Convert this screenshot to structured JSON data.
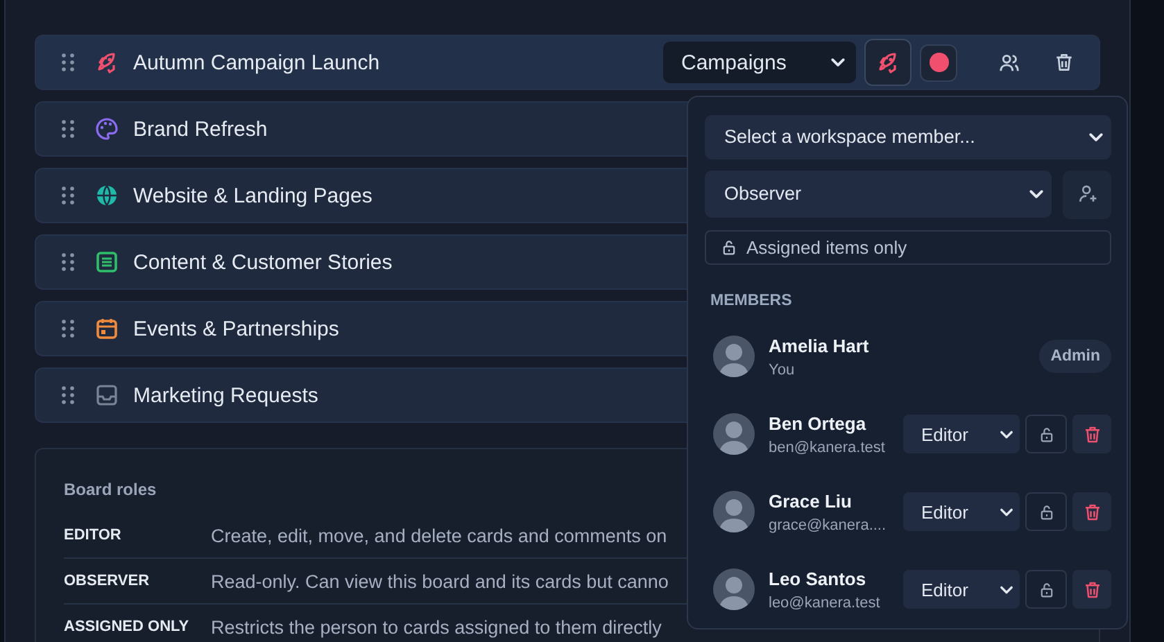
{
  "boards": [
    {
      "title": "Autumn Campaign Launch",
      "kind": "rocket",
      "color": "#f0506e",
      "selected": true,
      "category": "Campaigns"
    },
    {
      "title": "Brand Refresh",
      "kind": "palette",
      "color": "#8b6cf0",
      "selected": false
    },
    {
      "title": "Website & Landing Pages",
      "kind": "globe",
      "color": "#20b8a8",
      "selected": false
    },
    {
      "title": "Content & Customer Stories",
      "kind": "list",
      "color": "#2fbf6a",
      "selected": false
    },
    {
      "title": "Events & Partnerships",
      "kind": "calendar",
      "color": "#f08a3c",
      "selected": false
    },
    {
      "title": "Marketing Requests",
      "kind": "inbox",
      "color": "#7a8496",
      "selected": false
    }
  ],
  "board_roles": {
    "title": "Board roles",
    "roles": [
      {
        "name": "EDITOR",
        "description": "Create, edit, move, and delete cards and comments on"
      },
      {
        "name": "OBSERVER",
        "description": "Read-only. Can view this board and its cards but canno"
      },
      {
        "name": "ASSIGNED ONLY",
        "description": "Restricts the person to cards assigned to them directly"
      }
    ]
  },
  "share_popover": {
    "member_select": {
      "placeholder": "Select a workspace member..."
    },
    "role_select": {
      "value": "Observer"
    },
    "assigned_only": {
      "label": "Assigned items only",
      "checked": false
    },
    "members_heading": "MEMBERS",
    "members": [
      {
        "name": "Amelia Hart",
        "detail": "You",
        "kind": "admin",
        "role": "Admin"
      },
      {
        "name": "Ben Ortega",
        "detail": "ben@kanera.test",
        "kind": "member",
        "role": "Editor",
        "assigned_only": false
      },
      {
        "name": "Grace Liu",
        "detail": "grace@kanera....",
        "kind": "member",
        "role": "Editor",
        "assigned_only": false
      },
      {
        "name": "Leo Santos",
        "detail": "leo@kanera.test",
        "kind": "member",
        "role": "Editor",
        "assigned_only": false
      }
    ]
  }
}
